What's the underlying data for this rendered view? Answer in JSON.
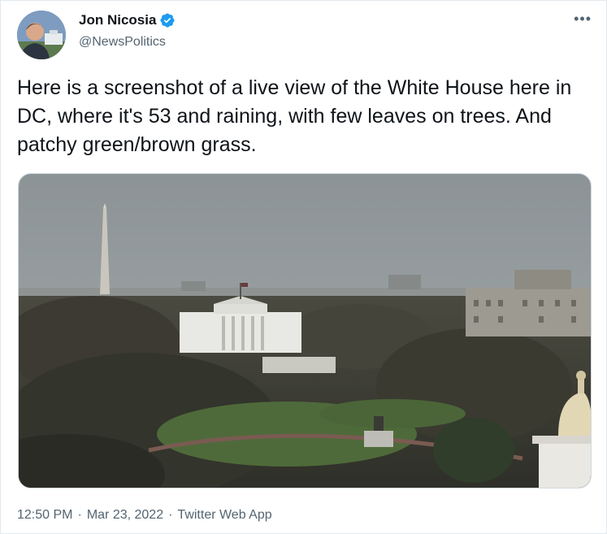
{
  "author": {
    "display_name": "Jon Nicosia",
    "handle": "@NewsPolitics",
    "verified": true,
    "avatar_icon": "profile-photo-avatar"
  },
  "tweet": {
    "text": "Here is a screenshot of a live view of the White House here in DC, where it's 53 and raining, with few leaves on trees. And patchy green/brown grass."
  },
  "meta": {
    "time": "12:50 PM",
    "separator1": "·",
    "date": "Mar 23, 2022",
    "separator2": "·",
    "source": "Twitter Web App"
  },
  "icons": {
    "more": "more-options-icon",
    "verified": "verified-badge-icon"
  },
  "colors": {
    "verified_blue": "#1d9bf0",
    "secondary_text": "#536471",
    "primary_text": "#0f1419"
  }
}
